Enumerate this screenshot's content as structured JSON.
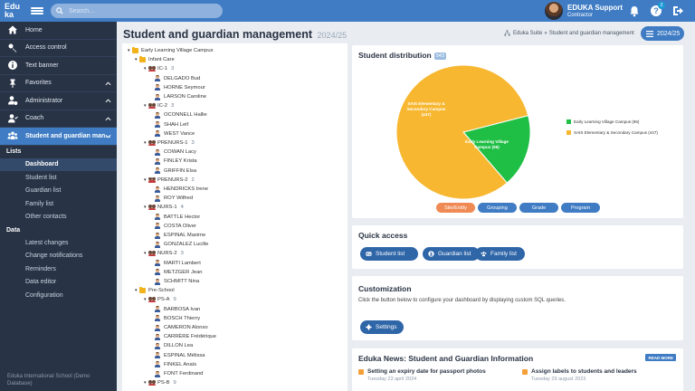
{
  "topbar": {
    "logo_line1": "Edu",
    "logo_line2": "ka",
    "search_placeholder": "Search...",
    "user_name": "EDUKA Support",
    "user_role": "Contractor",
    "help_badge": "2"
  },
  "sidebar": {
    "items": [
      {
        "label": "Home",
        "icon": "home-icon"
      },
      {
        "label": "Access control",
        "icon": "key-icon"
      },
      {
        "label": "Text banner",
        "icon": "info-icon"
      },
      {
        "label": "Favorites",
        "icon": "pin-icon"
      },
      {
        "label": "Administrator",
        "icon": "user-gear-icon"
      },
      {
        "label": "Coach",
        "icon": "user-check-icon"
      },
      {
        "label": "Student and guardian man...",
        "icon": "users-icon"
      }
    ],
    "lists_heading": "Lists",
    "lists": [
      "Dashboard",
      "Student list",
      "Guardian list",
      "Family list",
      "Other contacts"
    ],
    "data_heading": "Data",
    "data": [
      "Latest changes",
      "Change notifications",
      "Reminders",
      "Data editor",
      "Configuration"
    ],
    "footer": "Eduka International School (Demo Database)"
  },
  "page": {
    "title": "Student and guardian management",
    "year": "2024/25",
    "breadcrumb_root": "Eduka Suite",
    "breadcrumb_sep": "»",
    "breadcrumb_current": "Student and guardian management",
    "year_button": "2024/25"
  },
  "tree": {
    "campus": "Early Learning Village Campus",
    "groups": [
      {
        "name": "Infant Care",
        "classes": [
          {
            "name": "IC-1",
            "count": "3",
            "students": [
              "DELGADO Bud",
              "HORNE Seymour",
              "LARSON Caroline"
            ]
          },
          {
            "name": "IC-2",
            "count": "3",
            "students": [
              "OCONNELL Hallie",
              "SHAH Leif",
              "WEST Vance"
            ]
          },
          {
            "name": "PRENURS-1",
            "count": "3",
            "students": [
              "COWAN Lacy",
              "FINLEY Krista",
              "GRIFFIN Elsa"
            ]
          },
          {
            "name": "PRENURS-2",
            "count": "2",
            "students": [
              "HENDRICKS Irene",
              "ROY Wilfred"
            ]
          },
          {
            "name": "NURS-1",
            "count": "4",
            "students": [
              "BATTLE Hector",
              "COSTA Oliver",
              "ESPINAL Maxime",
              "GONZALEZ Lucille"
            ]
          },
          {
            "name": "NURS-2",
            "count": "3",
            "students": [
              "MARTI Lambert",
              "METZGER Jean",
              "SCHMITT Nina"
            ]
          }
        ]
      },
      {
        "name": "Pre-School",
        "classes": [
          {
            "name": "PS-A",
            "count": "9",
            "students": [
              "BARBOSA Ivan",
              "BOSCH Thierry",
              "CAMERON Alonso",
              "CARRÈRE Frédérique",
              "DILLON Lea",
              "ESPINAL Mélissa",
              "FINKEL Anaïs",
              "FONT Ferdinand"
            ]
          },
          {
            "name": "PS-B",
            "count": "9",
            "students": []
          }
        ]
      }
    ]
  },
  "distribution": {
    "title": "Student distribution",
    "total": "543",
    "tabs": [
      "Site/Entity",
      "Grouping",
      "Grade",
      "Program"
    ],
    "active_tab": "Site/Entity",
    "colors": {
      "green": "#1fbf45",
      "orange": "#f7b731"
    },
    "slice_labels": [
      {
        "line1": "SAIS Elementary &",
        "line2": "Secondary Campus",
        "line3": "(447)"
      },
      {
        "line1": "Early Learning Village",
        "line2": "Campus (96)"
      }
    ],
    "legend": [
      "Early Learning Village Campus (96)",
      "SAIS Elementary & Secondary Campus (447)"
    ]
  },
  "chart_data": {
    "type": "pie",
    "categories": [
      "Early Learning Village Campus",
      "SAIS Elementary & Secondary Campus"
    ],
    "values": [
      96,
      447
    ],
    "colors": [
      "#1fbf45",
      "#f7b731"
    ],
    "legend_position": "right"
  },
  "quick_access": {
    "title": "Quick access",
    "buttons": [
      "Student list",
      "Guardian list",
      "Family list"
    ]
  },
  "customization": {
    "title": "Customization",
    "description": "Click the button below to configure your dashboard by displaying custom SQL queries.",
    "button": "Settings"
  },
  "news": {
    "title": "Eduka News: Student and Guardian Information",
    "read_more": "READ MORE",
    "items": [
      {
        "title": "Setting an expiry date for passport photos",
        "date": "Tuesday 23 april 2024"
      },
      {
        "title": "Assign labels to students and leaders",
        "date": "Tuesday 29 august 2023"
      }
    ]
  }
}
